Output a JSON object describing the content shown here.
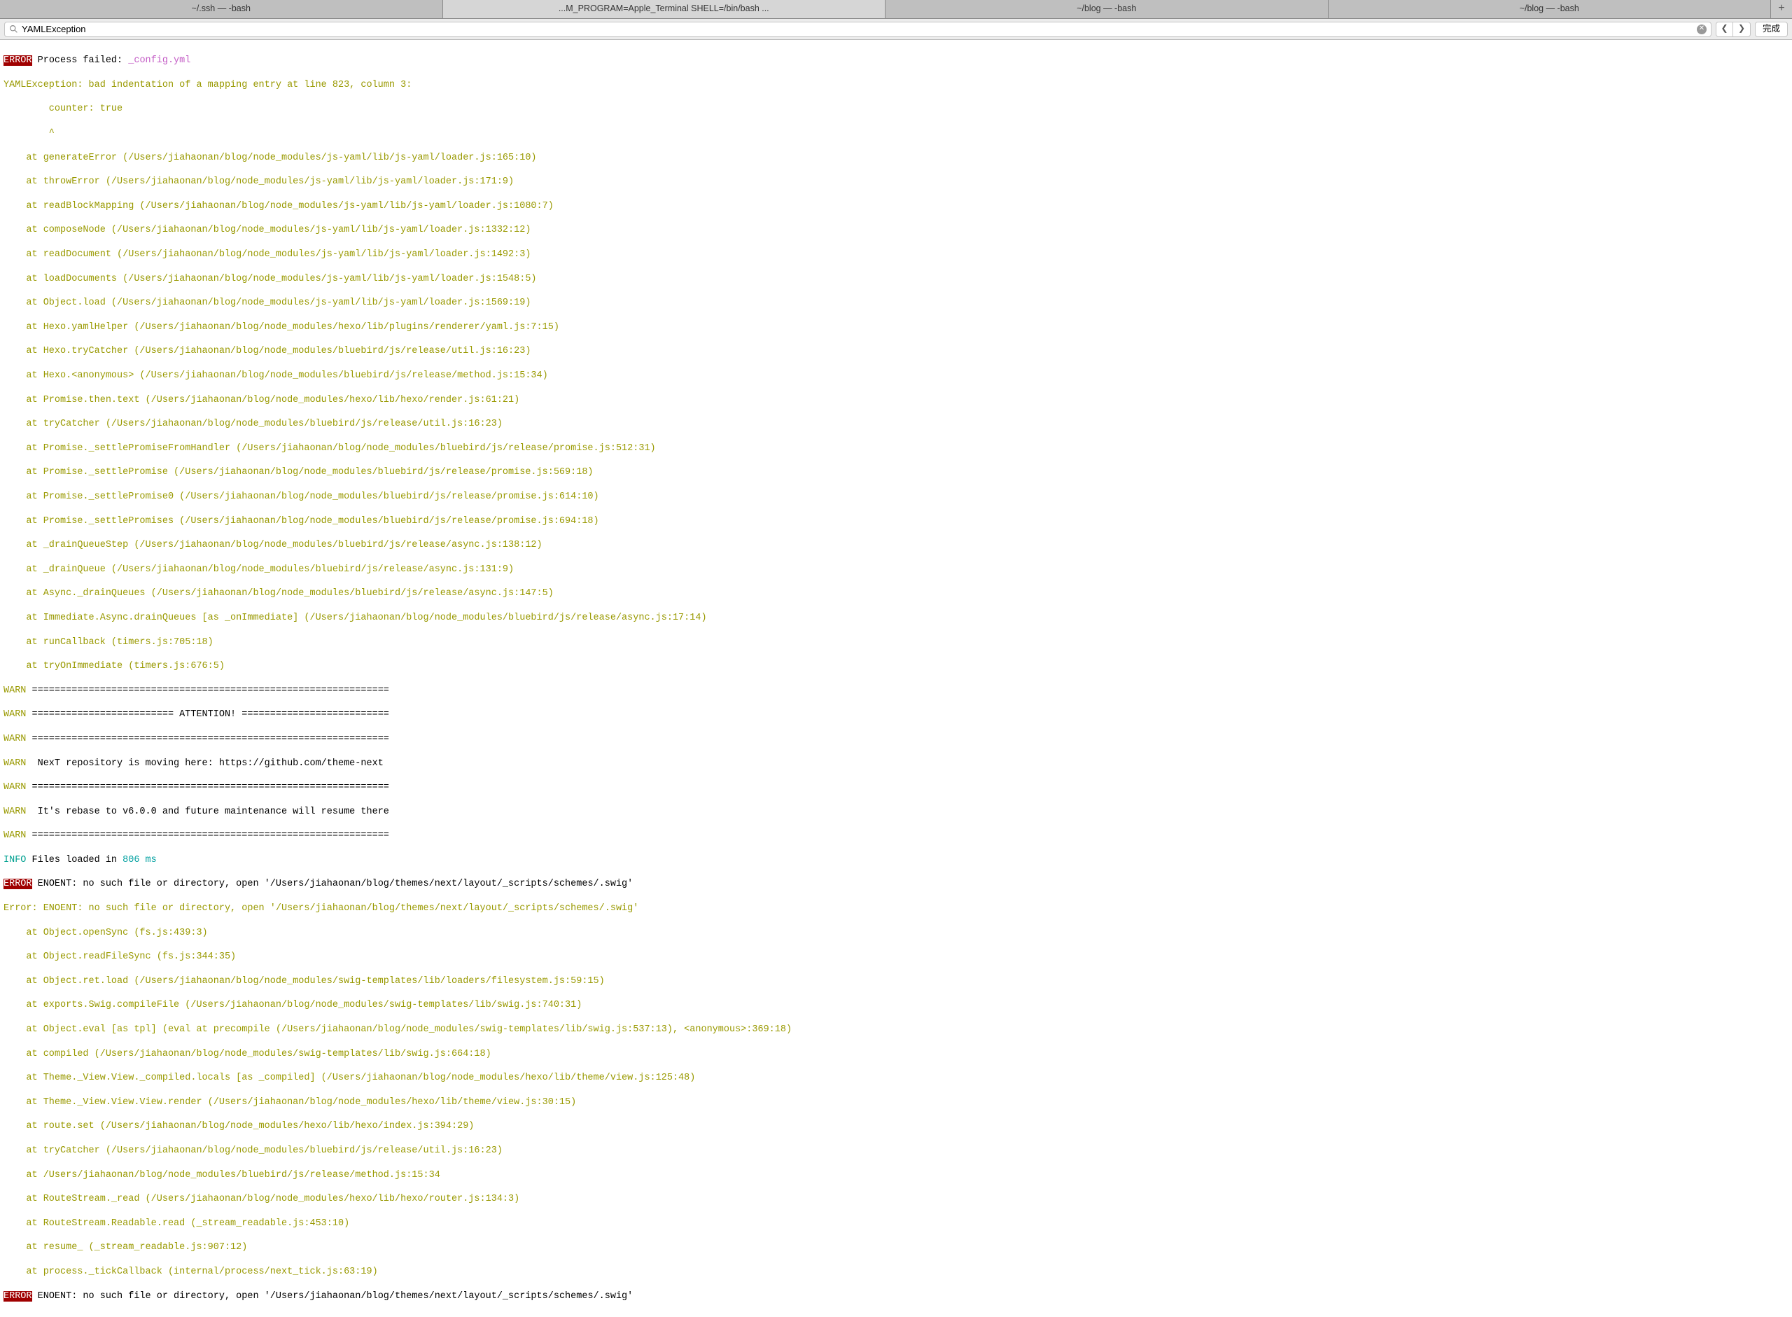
{
  "tabs": [
    {
      "label": "~/.ssh — -bash"
    },
    {
      "label": "...M_PROGRAM=Apple_Terminal SHELL=/bin/bash  ..."
    },
    {
      "label": "~/blog — -bash"
    },
    {
      "label": "~/blog — -bash"
    }
  ],
  "search": {
    "value": "YAMLException",
    "done": "完成"
  },
  "error1": {
    "badge": "ERROR",
    "prefix": " Process failed: ",
    "file": "_config.yml"
  },
  "yaml_msg": "YAMLException: bad indentation of a mapping entry at line 823, column 3:",
  "yaml_snip1": "        counter: true",
  "yaml_snip2": "        ^",
  "trace1": [
    "    at generateError (/Users/jiahaonan/blog/node_modules/js-yaml/lib/js-yaml/loader.js:165:10)",
    "    at throwError (/Users/jiahaonan/blog/node_modules/js-yaml/lib/js-yaml/loader.js:171:9)",
    "    at readBlockMapping (/Users/jiahaonan/blog/node_modules/js-yaml/lib/js-yaml/loader.js:1080:7)",
    "    at composeNode (/Users/jiahaonan/blog/node_modules/js-yaml/lib/js-yaml/loader.js:1332:12)",
    "    at readDocument (/Users/jiahaonan/blog/node_modules/js-yaml/lib/js-yaml/loader.js:1492:3)",
    "    at loadDocuments (/Users/jiahaonan/blog/node_modules/js-yaml/lib/js-yaml/loader.js:1548:5)",
    "    at Object.load (/Users/jiahaonan/blog/node_modules/js-yaml/lib/js-yaml/loader.js:1569:19)",
    "    at Hexo.yamlHelper (/Users/jiahaonan/blog/node_modules/hexo/lib/plugins/renderer/yaml.js:7:15)",
    "    at Hexo.tryCatcher (/Users/jiahaonan/blog/node_modules/bluebird/js/release/util.js:16:23)",
    "    at Hexo.<anonymous> (/Users/jiahaonan/blog/node_modules/bluebird/js/release/method.js:15:34)",
    "    at Promise.then.text (/Users/jiahaonan/blog/node_modules/hexo/lib/hexo/render.js:61:21)",
    "    at tryCatcher (/Users/jiahaonan/blog/node_modules/bluebird/js/release/util.js:16:23)",
    "    at Promise._settlePromiseFromHandler (/Users/jiahaonan/blog/node_modules/bluebird/js/release/promise.js:512:31)",
    "    at Promise._settlePromise (/Users/jiahaonan/blog/node_modules/bluebird/js/release/promise.js:569:18)",
    "    at Promise._settlePromise0 (/Users/jiahaonan/blog/node_modules/bluebird/js/release/promise.js:614:10)",
    "    at Promise._settlePromises (/Users/jiahaonan/blog/node_modules/bluebird/js/release/promise.js:694:18)",
    "    at _drainQueueStep (/Users/jiahaonan/blog/node_modules/bluebird/js/release/async.js:138:12)",
    "    at _drainQueue (/Users/jiahaonan/blog/node_modules/bluebird/js/release/async.js:131:9)",
    "    at Async._drainQueues (/Users/jiahaonan/blog/node_modules/bluebird/js/release/async.js:147:5)",
    "    at Immediate.Async.drainQueues [as _onImmediate] (/Users/jiahaonan/blog/node_modules/bluebird/js/release/async.js:17:14)",
    "    at runCallback (timers.js:705:18)",
    "    at tryOnImmediate (timers.js:676:5)"
  ],
  "warns": [
    " ===============================================================",
    " ========================= ATTENTION! ==========================",
    " ===============================================================",
    "  NexT repository is moving here: https://github.com/theme-next",
    " ===============================================================",
    "  It's rebase to v6.0.0 and future maintenance will resume there",
    " ==============================================================="
  ],
  "warn_badge": "WARN",
  "info": {
    "badge": "INFO",
    "prefix": " Files loaded in ",
    "time": "806 ms"
  },
  "error2": {
    "badge": "ERROR",
    "msg": " ENOENT: no such file or directory, open '/Users/jiahaonan/blog/themes/next/layout/_scripts/schemes/.swig'"
  },
  "err2_line": "Error: ENOENT: no such file or directory, open '/Users/jiahaonan/blog/themes/next/layout/_scripts/schemes/.swig'",
  "trace2": [
    "    at Object.openSync (fs.js:439:3)",
    "    at Object.readFileSync (fs.js:344:35)",
    "    at Object.ret.load (/Users/jiahaonan/blog/node_modules/swig-templates/lib/loaders/filesystem.js:59:15)",
    "    at exports.Swig.compileFile (/Users/jiahaonan/blog/node_modules/swig-templates/lib/swig.js:740:31)",
    "    at Object.eval [as tpl] (eval at precompile (/Users/jiahaonan/blog/node_modules/swig-templates/lib/swig.js:537:13), <anonymous>:369:18)",
    "    at compiled (/Users/jiahaonan/blog/node_modules/swig-templates/lib/swig.js:664:18)",
    "    at Theme._View.View._compiled.locals [as _compiled] (/Users/jiahaonan/blog/node_modules/hexo/lib/theme/view.js:125:48)",
    "    at Theme._View.View.View.render (/Users/jiahaonan/blog/node_modules/hexo/lib/theme/view.js:30:15)",
    "    at route.set (/Users/jiahaonan/blog/node_modules/hexo/lib/hexo/index.js:394:29)",
    "    at tryCatcher (/Users/jiahaonan/blog/node_modules/bluebird/js/release/util.js:16:23)",
    "    at /Users/jiahaonan/blog/node_modules/bluebird/js/release/method.js:15:34",
    "    at RouteStream._read (/Users/jiahaonan/blog/node_modules/hexo/lib/hexo/router.js:134:3)",
    "    at RouteStream.Readable.read (_stream_readable.js:453:10)",
    "    at resume_ (_stream_readable.js:907:12)",
    "    at process._tickCallback (internal/process/next_tick.js:63:19)"
  ],
  "error3": {
    "badge": "ERROR",
    "msg": " ENOENT: no such file or directory, open '/Users/jiahaonan/blog/themes/next/layout/_scripts/schemes/.swig'"
  }
}
